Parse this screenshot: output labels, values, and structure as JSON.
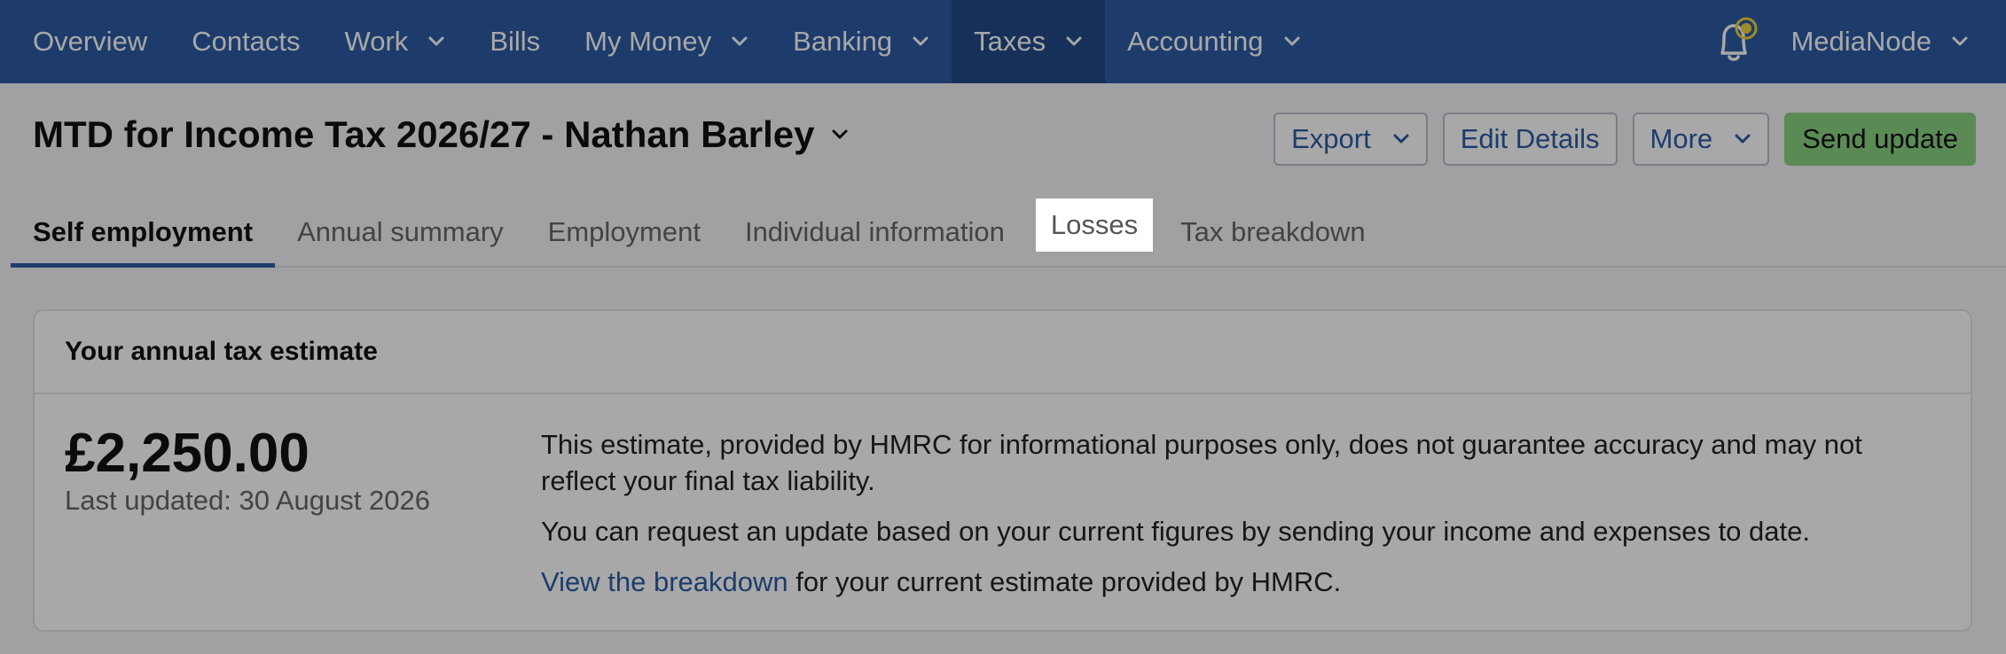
{
  "nav": {
    "items": [
      {
        "label": "Overview"
      },
      {
        "label": "Contacts"
      },
      {
        "label": "Work"
      },
      {
        "label": "Bills"
      },
      {
        "label": "My Money"
      },
      {
        "label": "Banking"
      },
      {
        "label": "Taxes"
      },
      {
        "label": "Accounting"
      }
    ],
    "user": "MediaNode",
    "bell_icon": "bell-icon"
  },
  "header": {
    "title": "MTD for Income Tax 2026/27 - Nathan Barley",
    "export": "Export",
    "edit_details": "Edit Details",
    "more": "More",
    "send_update": "Send update"
  },
  "tabs": [
    {
      "label": "Self employment"
    },
    {
      "label": "Annual summary"
    },
    {
      "label": "Employment"
    },
    {
      "label": "Individual information"
    },
    {
      "label": "Losses"
    },
    {
      "label": "Tax breakdown"
    }
  ],
  "card": {
    "title": "Your annual tax estimate",
    "amount": "£2,250.00",
    "updated": "Last updated: 30 August 2026",
    "para1": "This estimate, provided by HMRC for informational purposes only, does not guarantee accuracy and may not reflect your final tax liability.",
    "para2": "You can request an update based on your current figures by sending your income and expenses to date.",
    "link": "View the breakdown",
    "para3_rest": " for your current estimate provided by HMRC."
  },
  "colors": {
    "nav_bg": "#2d5ca3",
    "nav_active": "#234a87",
    "primary_button": "#8bd382",
    "link": "#2d5ca3"
  }
}
